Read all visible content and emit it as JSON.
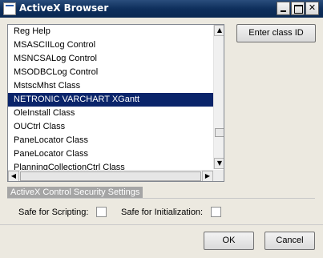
{
  "window": {
    "title": "ActiveX Browser",
    "controls": {
      "minimize": "",
      "maximize": "",
      "close": "✕"
    }
  },
  "list": {
    "items": [
      "Reg Help",
      "MSASCIILog Control",
      "MSNCSALog Control",
      "MSODBCLog Control",
      "MstscMhst Class",
      "NETRONIC VARCHART XGantt",
      "OleInstall Class",
      "OUCtrl Class",
      "PaneLocator Class",
      "PaneLocator Class",
      "PlanningCollectionCtrl Class"
    ],
    "selected_index": 5,
    "scroll_up_glyph": "▲",
    "scroll_down_glyph": "▼",
    "scroll_left_glyph": "◀",
    "scroll_right_glyph": "▶"
  },
  "buttons": {
    "enter_class_id": "Enter class ID",
    "ok": "OK",
    "cancel": "Cancel"
  },
  "security": {
    "group_title": "ActiveX Control Security Settings",
    "safe_for_scripting": "Safe for Scripting:",
    "safe_for_initialization": "Safe for Initialization:",
    "scripting_checked": false,
    "initialization_checked": false
  }
}
